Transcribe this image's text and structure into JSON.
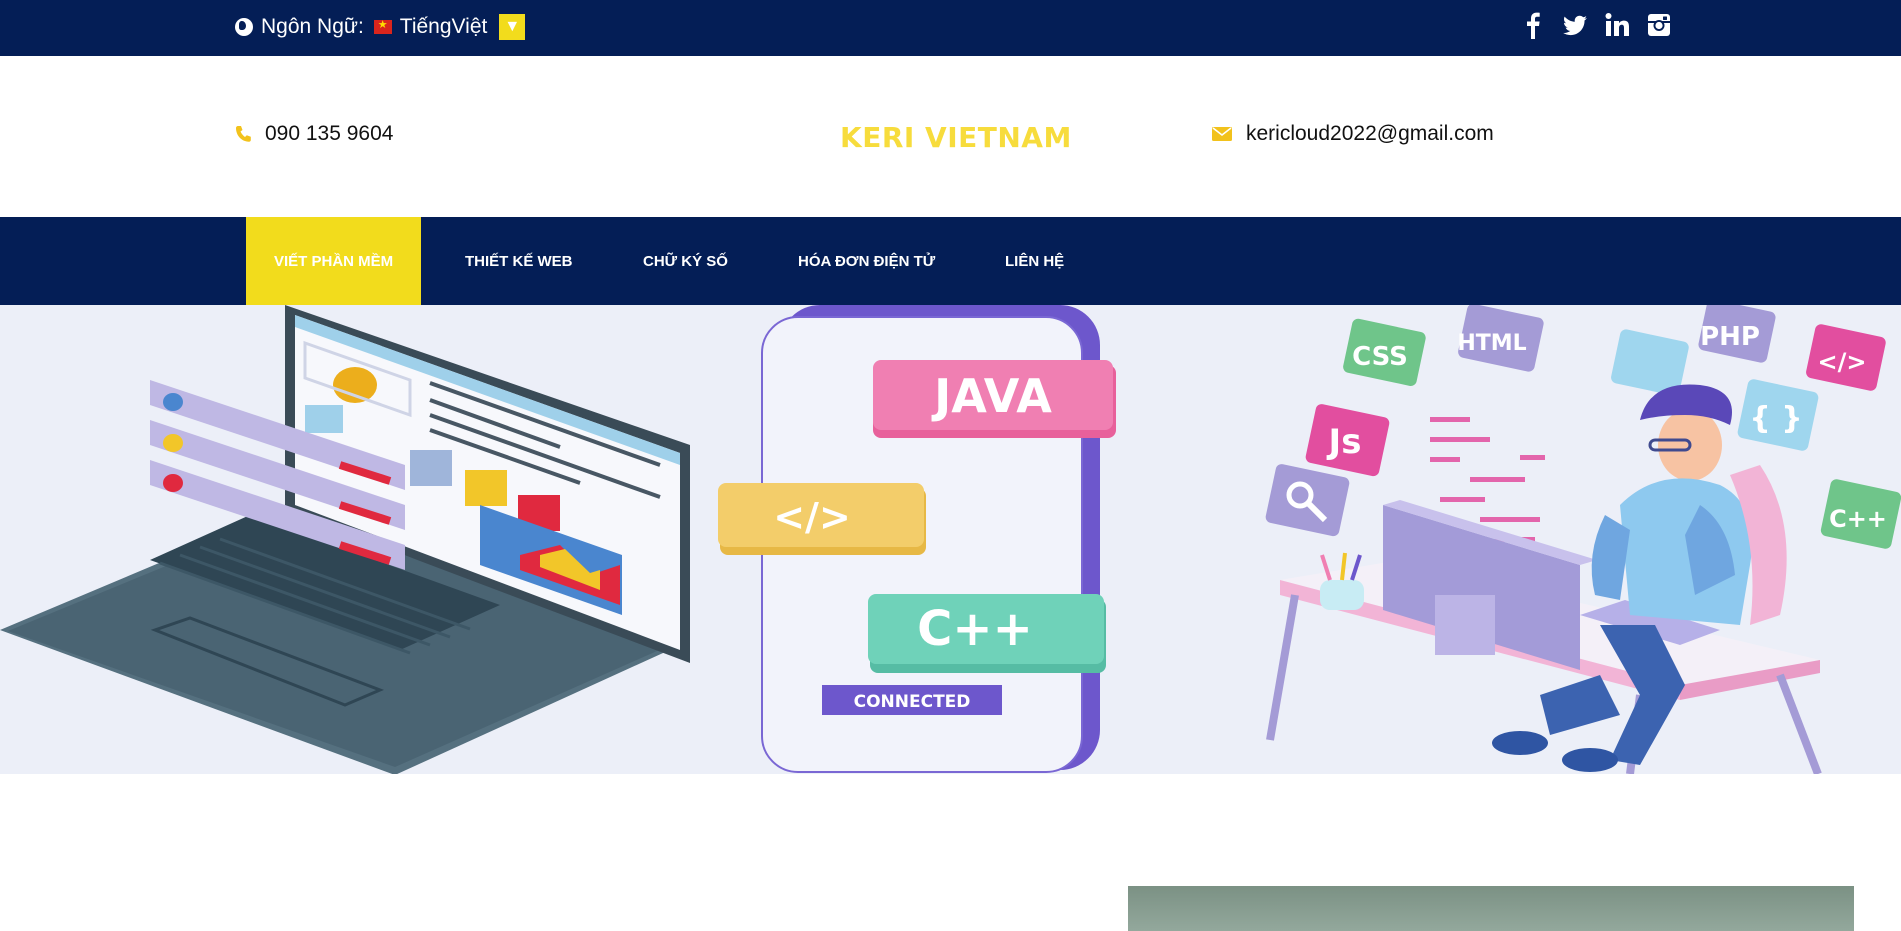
{
  "topbar": {
    "language_label": "Ngôn Ngữ:",
    "language_value": "TiếngViệt",
    "dropdown_glyph": "▼",
    "social": [
      "facebook-icon",
      "twitter-icon",
      "linkedin-icon",
      "instagram-icon"
    ]
  },
  "header": {
    "phone": "090 135 9604",
    "brand": "KERI VIETNAM",
    "email": "kericloud2022@gmail.com"
  },
  "nav": {
    "items": [
      {
        "label": "VIẾT PHẦN MỀM",
        "active": true
      },
      {
        "label": "THIẾT KẾ WEB",
        "active": false
      },
      {
        "label": "CHỮ KÝ SỐ",
        "active": false
      },
      {
        "label": "HÓA ĐƠN ĐIỆN TỬ",
        "active": false
      },
      {
        "label": "LIÊN HỆ",
        "active": false
      }
    ]
  },
  "hero": {
    "tags": [
      "JAVA",
      "</>",
      "C++",
      "CONNECTED",
      "CSS",
      "HTML",
      "PHP",
      "</>",
      "Js",
      "{ }",
      "C++"
    ]
  },
  "colors": {
    "navy": "#041e56",
    "accent": "#f2dc1c",
    "brand": "#f7dc3c",
    "hero_bg": "#eceff8"
  }
}
